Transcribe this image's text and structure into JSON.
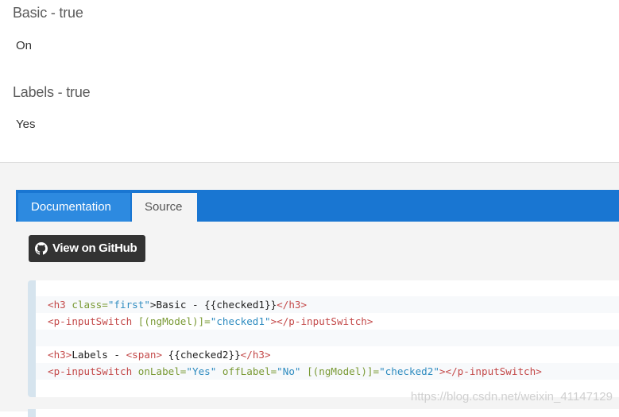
{
  "demo": {
    "basic_heading": "Basic - true",
    "basic_value": "On",
    "labels_heading": "Labels - true",
    "labels_value": "Yes"
  },
  "tabs": [
    {
      "label": "Documentation",
      "active": false
    },
    {
      "label": "Source",
      "active": true
    }
  ],
  "github_button": {
    "label": "View on GitHub",
    "icon": "github-icon"
  },
  "code": {
    "line1": {
      "tag_open": "<h3 ",
      "attr": "class=",
      "str": "\"first\"",
      "text": ">Basic - {{checked1}}",
      "tag_close": "</h3>"
    },
    "line2": {
      "tag_open": "<p-inputSwitch ",
      "attr": "[(ngModel)]=",
      "str": "\"checked1\"",
      "tag_close": "></p-inputSwitch>"
    },
    "line4": {
      "tag_open": "<h3>",
      "text1": "Labels - ",
      "span_open": "<span>",
      "text2": " {{checked2}}",
      "tag_close": "</h3>"
    },
    "line5": {
      "tag_open": "<p-inputSwitch ",
      "attr1": "onLabel=",
      "str1": "\"Yes\"",
      "attr2": " offLabel=",
      "str2": "\"No\"",
      "attr3": " [(ngModel)]=",
      "str3": "\"checked2\"",
      "tag_close": "></p-inputSwitch>"
    }
  },
  "watermark": "https://blog.csdn.net/weixin_41147129",
  "colors": {
    "tabbar": "#1976d2",
    "active_tab": "#2d8ae0",
    "button_bg": "#333333"
  }
}
